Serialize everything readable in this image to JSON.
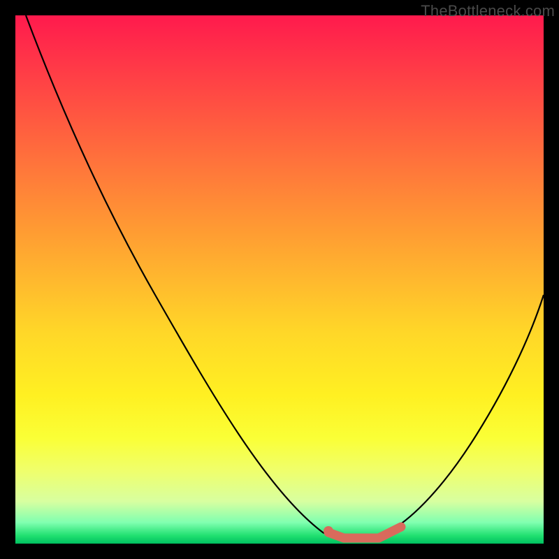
{
  "watermark": "TheBottleneck.com",
  "chart_data": {
    "type": "line",
    "title": "",
    "xlabel": "",
    "ylabel": "",
    "xlim": [
      0,
      100
    ],
    "ylim": [
      0,
      100
    ],
    "grid": false,
    "legend": false,
    "series": [
      {
        "name": "bottleneck-curve",
        "color": "#000000",
        "x": [
          2,
          10,
          20,
          30,
          40,
          50,
          55,
          60,
          65,
          70,
          75,
          80,
          85,
          90,
          95,
          100
        ],
        "y": [
          100,
          89,
          73,
          57,
          41,
          23,
          14,
          6,
          1,
          0,
          1,
          5,
          14,
          26,
          40,
          55
        ]
      },
      {
        "name": "optimal-range",
        "color": "#d96a5c",
        "x": [
          60,
          65,
          70,
          74
        ],
        "y": [
          3,
          1,
          1,
          4
        ]
      }
    ],
    "annotations": [
      {
        "name": "optimal-start-dot",
        "x": 60,
        "y": 3
      }
    ]
  }
}
